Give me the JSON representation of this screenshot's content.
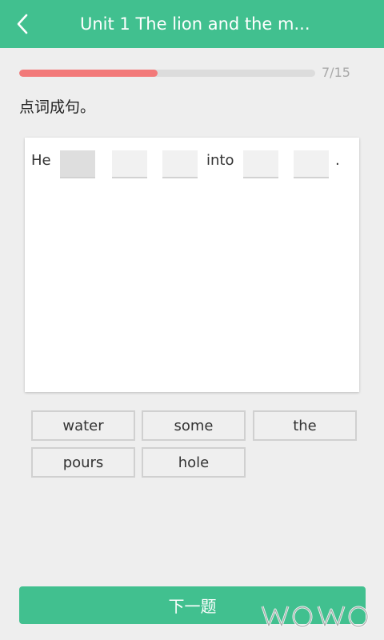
{
  "header": {
    "title": "Unit 1 The lion and the m..."
  },
  "progress": {
    "current": 7,
    "total": 15,
    "fraction": 0.4667,
    "label": "7/15"
  },
  "question": {
    "instruction": "点词成句。",
    "sentence": {
      "start": "He",
      "middle": "into",
      "end": "."
    }
  },
  "options": [
    "water",
    "some",
    "the",
    "pours",
    "hole"
  ],
  "footer": {
    "next_label": "下一题"
  },
  "colors": {
    "accent": "#41c08f",
    "progress": "#f27979"
  }
}
